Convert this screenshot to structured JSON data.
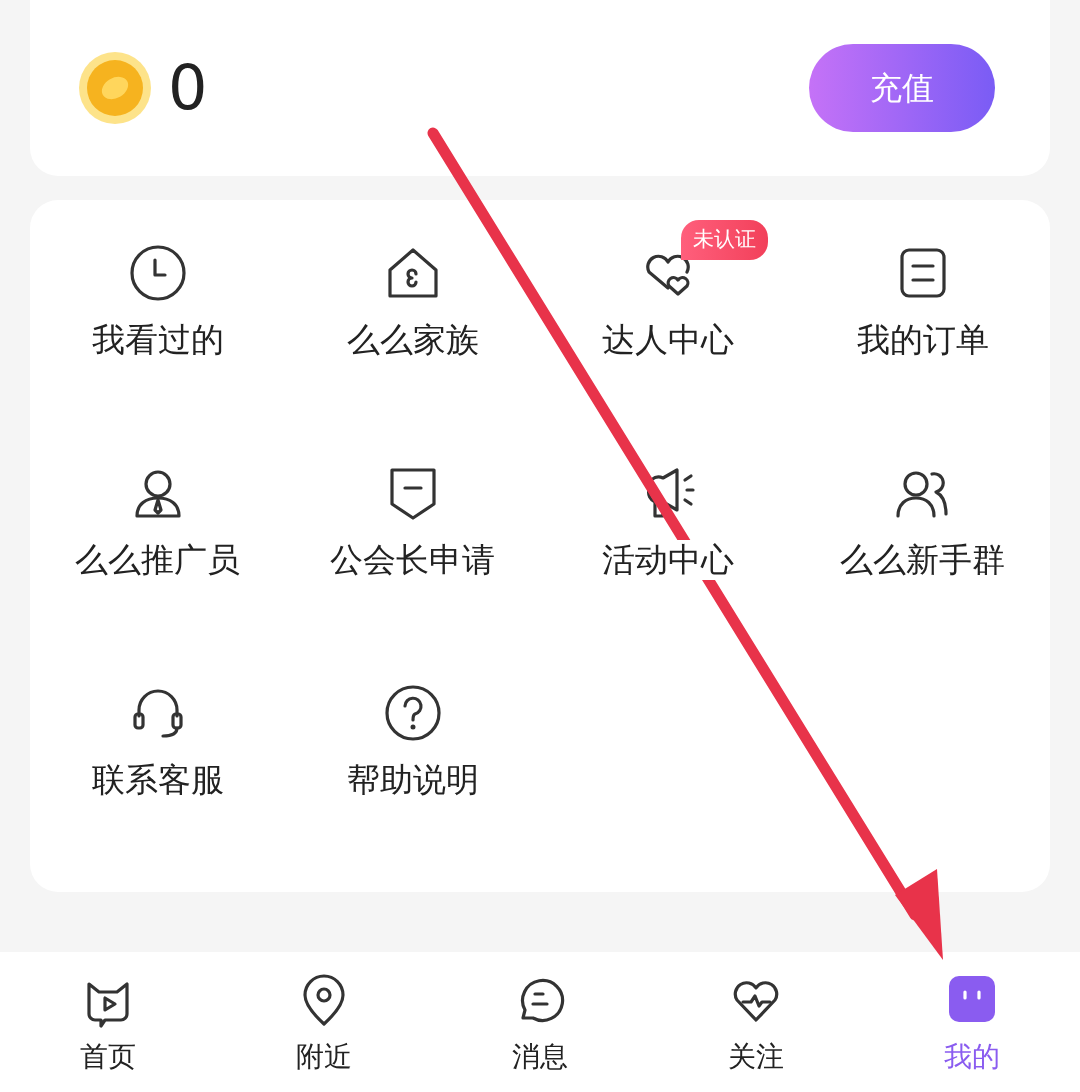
{
  "balance": {
    "amount": "0"
  },
  "recharge_button": "充值",
  "menu_items": [
    {
      "label": "我看过的"
    },
    {
      "label": "么么家族"
    },
    {
      "label": "达人中心",
      "badge": "未认证"
    },
    {
      "label": "我的订单"
    },
    {
      "label": "么么推广员"
    },
    {
      "label": "公会长申请"
    },
    {
      "label": "活动中心"
    },
    {
      "label": "么么新手群"
    },
    {
      "label": "联系客服"
    },
    {
      "label": "帮助说明"
    }
  ],
  "tab_bar": [
    {
      "label": "首页",
      "selected": false
    },
    {
      "label": "附近",
      "selected": false
    },
    {
      "label": "消息",
      "selected": false
    },
    {
      "label": "关注",
      "selected": false
    },
    {
      "label": "我的",
      "selected": true
    }
  ]
}
